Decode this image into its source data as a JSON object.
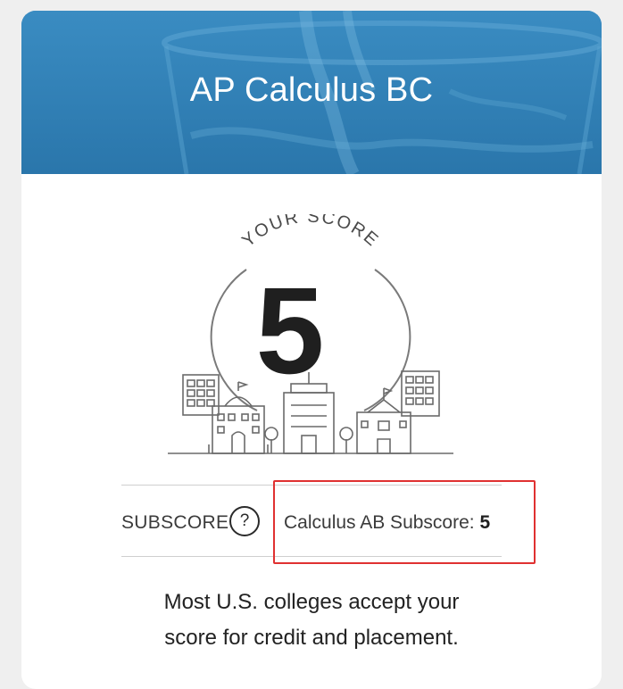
{
  "header": {
    "title": "AP Calculus BC",
    "background_color": "#2f7fb6"
  },
  "score": {
    "caption": "YOUR SCORE",
    "value": "5",
    "illustration": "campus-buildings-icon"
  },
  "subscore": {
    "label": "SUBSCORE",
    "help_icon": "question-mark-icon",
    "name": "Calculus AB Subscore:",
    "value": "5"
  },
  "note": {
    "line1": "Most U.S. colleges accept your",
    "line2": "score for credit and placement."
  },
  "colors": {
    "highlight": "#e03131",
    "divider": "#cfcfcf",
    "text": "#222222"
  }
}
